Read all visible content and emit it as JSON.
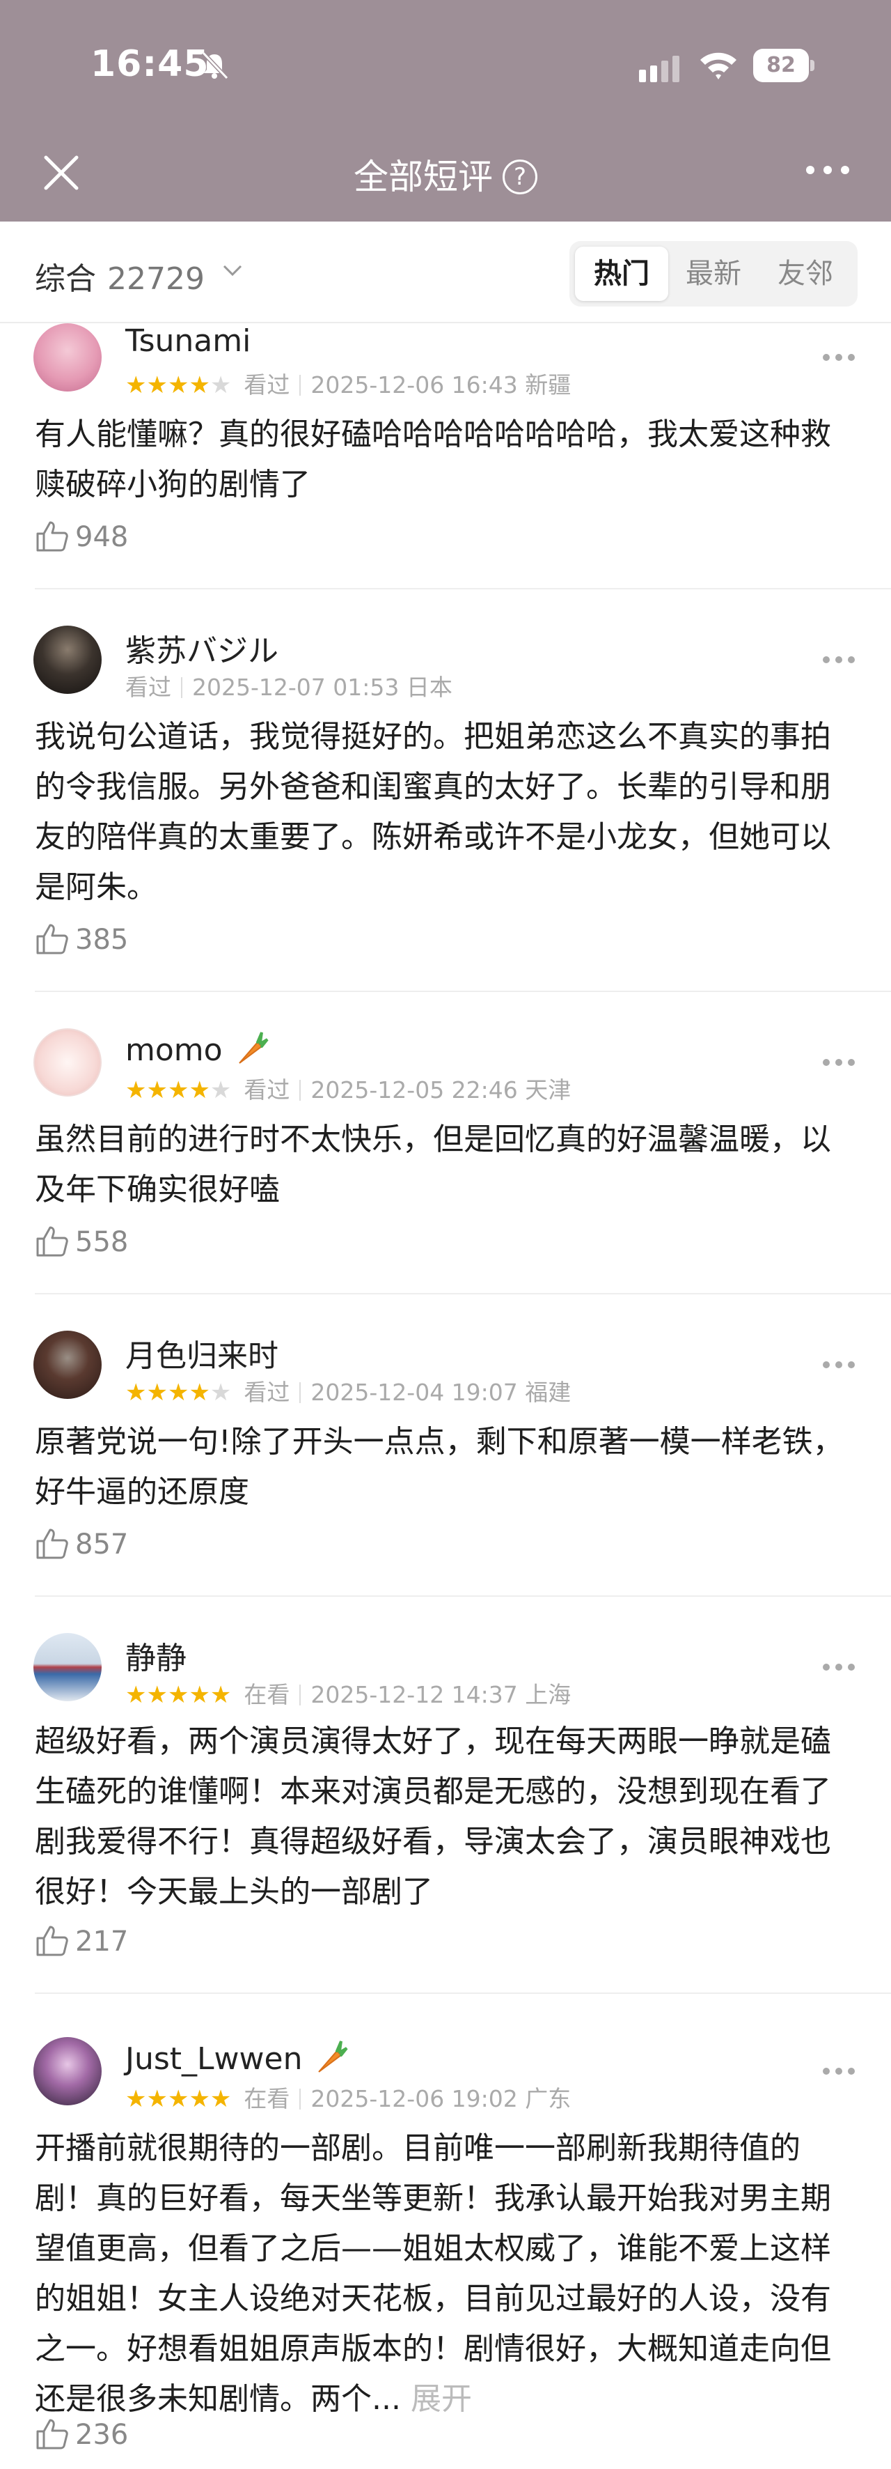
{
  "status_bar": {
    "time": "16:45",
    "battery": "82"
  },
  "nav": {
    "title": "全部短评",
    "help_glyph": "?"
  },
  "filter": {
    "sort_label": "综合",
    "count": "22729",
    "tabs": [
      "热门",
      "最新",
      "友邻"
    ],
    "active_tab": "热门"
  },
  "comments": [
    {
      "user": "Tsunami",
      "stars": 4,
      "status": "看过",
      "datetime": "2025-12-06 16:43",
      "location": "新疆",
      "text": "有人能懂嘛？真的很好磕哈哈哈哈哈哈哈哈，我太爱这种救赎破碎小狗的剧情了",
      "likes": "948",
      "badge": false
    },
    {
      "user": "紫苏バジル",
      "stars": 0,
      "status": "看过",
      "datetime": "2025-12-07 01:53",
      "location": "日本",
      "text": "我说句公道话，我觉得挺好的。把姐弟恋这么不真实的事拍的令我信服。另外爸爸和闺蜜真的太好了。长辈的引导和朋友的陪伴真的太重要了。陈妍希或许不是小龙女，但她可以是阿朱。",
      "likes": "385",
      "badge": false
    },
    {
      "user": "momo",
      "stars": 4,
      "status": "看过",
      "datetime": "2025-12-05 22:46",
      "location": "天津",
      "text": "虽然目前的进行时不太快乐，但是回忆真的好温馨温暖，以及年下确实很好嗑",
      "likes": "558",
      "badge": true
    },
    {
      "user": "月色归来时",
      "stars": 4,
      "status": "看过",
      "datetime": "2025-12-04 19:07",
      "location": "福建",
      "text": "原著党说一句!除了开头一点点，剩下和原著一模一样老铁，好牛逼的还原度",
      "likes": "857",
      "badge": false
    },
    {
      "user": "静静",
      "stars": 5,
      "status": "在看",
      "datetime": "2025-12-12 14:37",
      "location": "上海",
      "text": "超级好看，两个演员演得太好了，现在每天两眼一睁就是磕生磕死的谁懂啊！本来对演员都是无感的，没想到现在看了剧我爱得不行！真得超级好看，导演太会了，演员眼神戏也很好！今天最上头的一部剧了",
      "likes": "217",
      "badge": false
    },
    {
      "user": "Just_Lwwen",
      "stars": 5,
      "status": "在看",
      "datetime": "2025-12-06 19:02",
      "location": "广东",
      "text": "开播前就很期待的一部剧。目前唯一一部刷新我期待值的剧！真的巨好看，每天坐等更新！我承认最开始我对男主期望值更高，但看了之后——姐姐太权威了，谁能不爱上这样的姐姐！女主人设绝对天花板，目前见过最好的人设，没有之一。好想看姐姐原声版本的！剧情很好，大概知道走向但还是很多未知剧情。两个...",
      "expand_label": "展开",
      "likes": "236",
      "badge": true
    }
  ],
  "colors": {
    "header": "#9e8f97",
    "star": "#f4b400",
    "carrot": "#f28c28"
  }
}
